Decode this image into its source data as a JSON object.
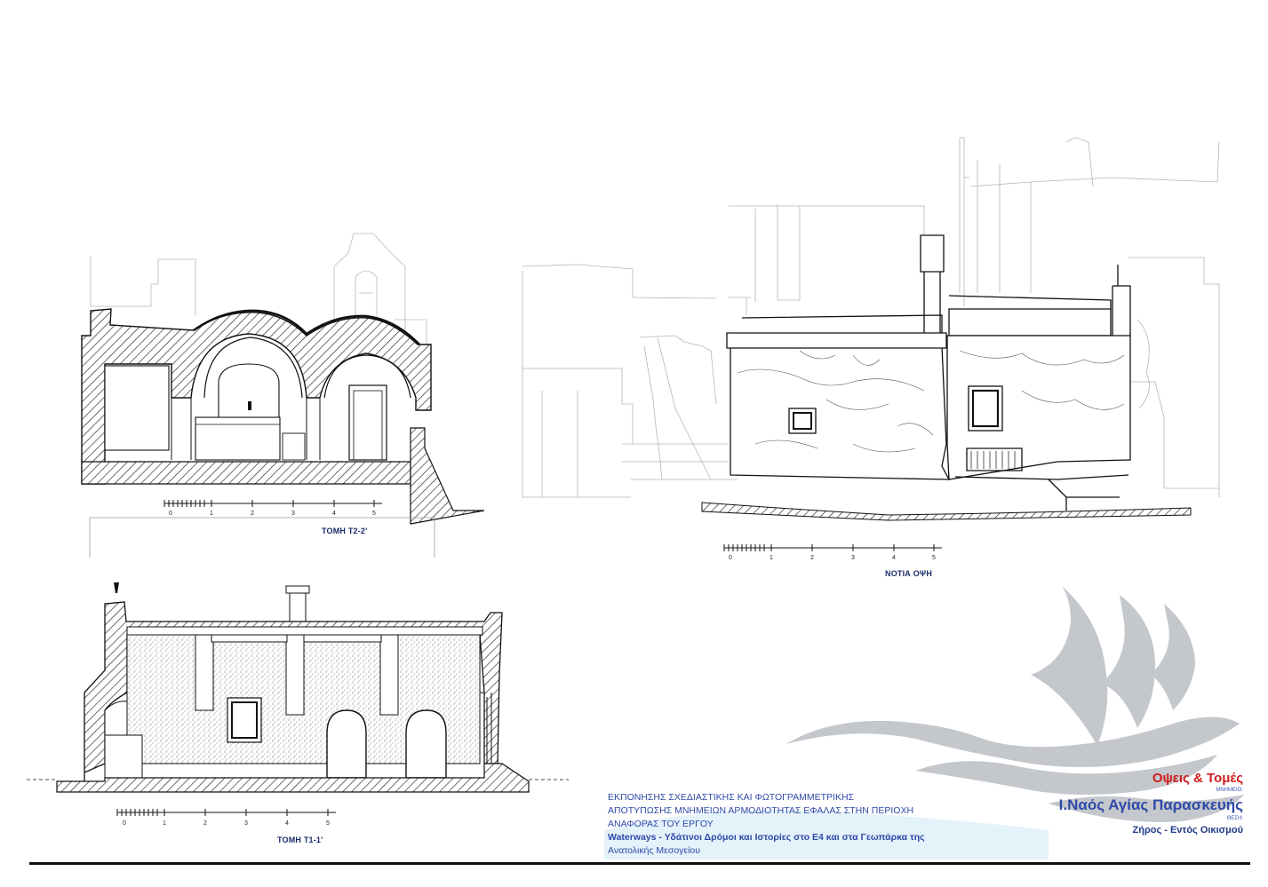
{
  "drawings": {
    "section_t2": {
      "label": "ΤΟΜΗ Τ2-2'",
      "scale_ticks": [
        "0",
        "1",
        "2",
        "3",
        "4",
        "5"
      ]
    },
    "south_elevation": {
      "label": "ΝΟΤΙΑ ΟΨΗ",
      "scale_ticks": [
        "0",
        "1",
        "2",
        "3",
        "4",
        "5"
      ]
    },
    "section_t1": {
      "label": "ΤΟΜΗ Τ1-1'",
      "scale_ticks": [
        "0",
        "1",
        "2",
        "3",
        "4",
        "5"
      ]
    }
  },
  "project_info": {
    "line1": "ΕΚΠΟΝΗΣΗΣ ΣΧΕΔΙΑΣΤΙΚΗΣ ΚΑΙ ΦΩΤΟΓΡΑΜΜΕΤΡΙΚΗΣ",
    "line2": "ΑΠΟΤΥΠΩΣΗΣ ΜΝΗΜΕΙΩΝ ΑΡΜΟΔΙΟΤΗΤΑΣ ΕΦΑΛΑΣ ΣΤΗΝ ΠΕΡΙΟΧΗ",
    "line3": "ΑΝΑΦΟΡΑΣ ΤΟΥ ΕΡΓΟΥ",
    "line4": "Waterways -  Υδάτινοι Δρόμοι και Ιστορίες στο Ε4 και στα Γεωπάρκα της",
    "line5": "Ανατολικής Μεσογείου"
  },
  "title_block": {
    "title": "Οψεις & Τομές",
    "monument_caption": "ΜΝΗΜΕΙΟ:",
    "monument": "Ι.Ναός Αγίας Παρασκευής",
    "location_caption": "ΘΕΣΗ:",
    "location": "Ζήρος - Εντός Οικισμού"
  },
  "colors": {
    "accent_red": "#d01c1c",
    "accent_blue": "#2f49a8",
    "logo_grey": "#c4c7cb"
  },
  "logo": {
    "icon": "sailboat-waves-logo"
  }
}
